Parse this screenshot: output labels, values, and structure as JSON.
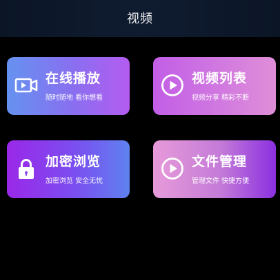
{
  "header": {
    "title": "视频"
  },
  "cards": [
    {
      "title": "在线播放",
      "subtitle": "随时随地 看你想看",
      "icon": "video-camera-icon"
    },
    {
      "title": "视频列表",
      "subtitle": "视频分享 精彩不断",
      "icon": "play-circle-icon"
    },
    {
      "title": "加密浏览",
      "subtitle": "加密浏览 安全无忧",
      "icon": "lock-icon"
    },
    {
      "title": "文件管理",
      "subtitle": "管理文件 快捷方便",
      "icon": "play-circle-icon"
    }
  ],
  "colors": {
    "background": "#000000",
    "header": "#0f1c30",
    "card_online": [
      "#6592f0",
      "#b45cf0"
    ],
    "card_list": [
      "#c25ee6",
      "#e08ed8"
    ],
    "card_encrypt": [
      "#9a28e8",
      "#5f82f0"
    ],
    "card_files": [
      "#e79ad9",
      "#8b30e0"
    ]
  }
}
